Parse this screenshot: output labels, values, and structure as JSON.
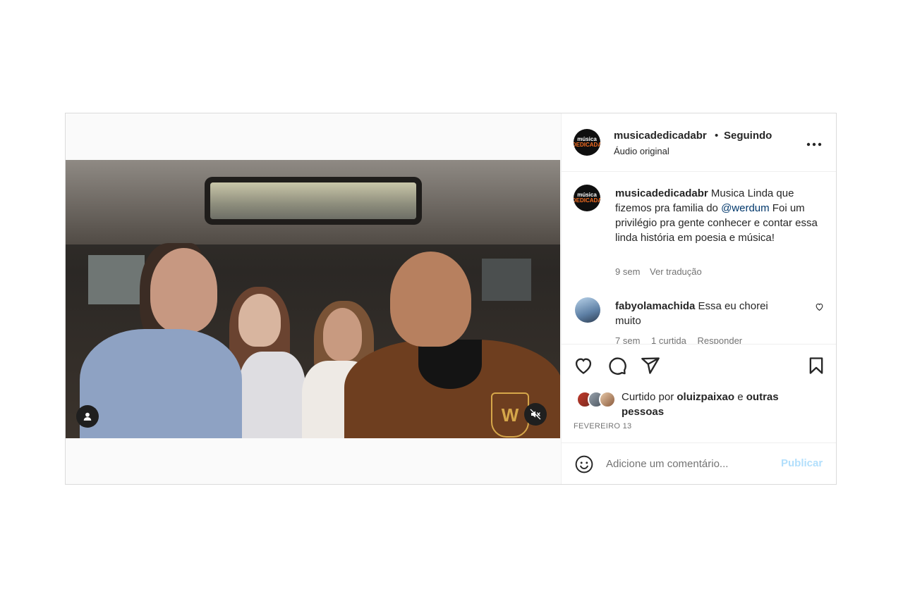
{
  "post": {
    "username": "musicadedicadabr",
    "separator": "•",
    "follow_status": "Seguindo",
    "audio_label": "Áudio original",
    "more_icon": "more-horizontal-icon",
    "avatar_logo_top": "música",
    "avatar_logo_bottom": "DEDICADA"
  },
  "video": {
    "crest_letter": "W",
    "user_icon": "user-icon",
    "mute_icon": "muted-speaker-icon"
  },
  "caption": {
    "username": "musicadedicadabr",
    "text_before": " Musica Linda que fizemos pra familia do ",
    "mention": "@werdum",
    "text_after": " Foi um privilégio pra gente conhecer e contar essa linda história em poesia e música!",
    "time": "9 sem",
    "translate": "Ver tradução"
  },
  "comments": [
    {
      "username": "fabyolamachida",
      "text": " Essa eu chorei muito",
      "time": "7 sem",
      "likes": "1 curtida",
      "reply": "Responder"
    }
  ],
  "actions": {
    "like_icon": "heart-icon",
    "comment_icon": "comment-icon",
    "share_icon": "send-icon",
    "save_icon": "bookmark-icon"
  },
  "likes": {
    "prefix": "Curtido por ",
    "user": "oluizpaixao",
    "middle": " e ",
    "suffix": "outras pessoas"
  },
  "date": "FEVEREIRO 13",
  "add_comment": {
    "placeholder": "Adicione um comentário...",
    "publish": "Publicar",
    "emoji_icon": "emoji-icon"
  },
  "colors": {
    "link": "#00376b",
    "publish_disabled": "#b2dffc",
    "secondary_text": "#737373",
    "border": "#dbdbdb"
  }
}
